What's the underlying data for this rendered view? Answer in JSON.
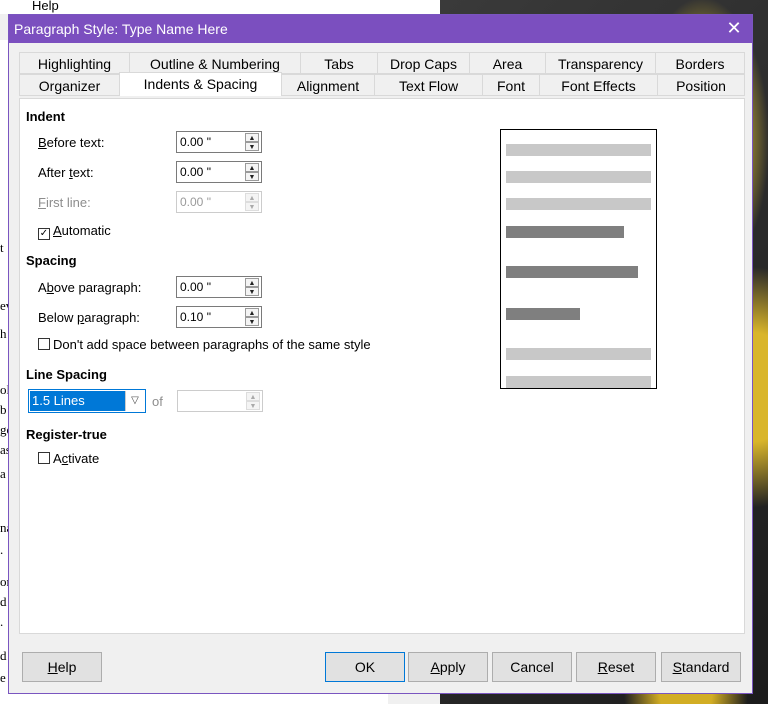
{
  "background": {
    "menu_help": "Help",
    "fragments": [
      "t",
      "ev",
      "h",
      "ol",
      "b",
      "ge",
      "as",
      "a",
      "na",
      ".",
      "on",
      "d s",
      ".",
      "d",
      "e"
    ]
  },
  "dialog": {
    "title": "Paragraph Style: Type Name Here",
    "close_glyph": "✕",
    "tabs_row1": [
      "Highlighting",
      "Outline & Numbering",
      "Tabs",
      "Drop Caps",
      "Area",
      "Transparency",
      "Borders"
    ],
    "tabs_row2": [
      "Organizer",
      "Indents & Spacing",
      "Alignment",
      "Text Flow",
      "Font",
      "Font Effects",
      "Position"
    ],
    "active_tab": "Indents & Spacing",
    "indent": {
      "heading": "Indent",
      "before_text": {
        "label": "Before text:",
        "value": "0.00 \""
      },
      "after_text": {
        "label": "After text:",
        "value": "0.00 \""
      },
      "first_line": {
        "label": "First line:",
        "value": "0.00 \""
      },
      "automatic": {
        "label": "Automatic",
        "checked": true
      }
    },
    "spacing": {
      "heading": "Spacing",
      "above": {
        "label": "Above paragraph:",
        "value": "0.00 \""
      },
      "below": {
        "label": "Below paragraph:",
        "value": "0.10 \""
      },
      "dont_add": {
        "label": "Don't add space between paragraphs of the same style",
        "checked": false
      }
    },
    "line_spacing": {
      "heading": "Line Spacing",
      "selected": "1.5 Lines",
      "of_label": "of",
      "of_value": ""
    },
    "register_true": {
      "heading": "Register-true",
      "activate": {
        "label": "Activate",
        "checked": false
      }
    },
    "buttons": {
      "help": "Help",
      "ok": "OK",
      "apply": "Apply",
      "cancel": "Cancel",
      "reset": "Reset",
      "standard": "Standard"
    },
    "colors": {
      "titlebar": "#7b4fbf",
      "accent": "#0078d7",
      "preview_light": "#c8c8c8",
      "preview_dark": "#7f7f7f"
    }
  }
}
